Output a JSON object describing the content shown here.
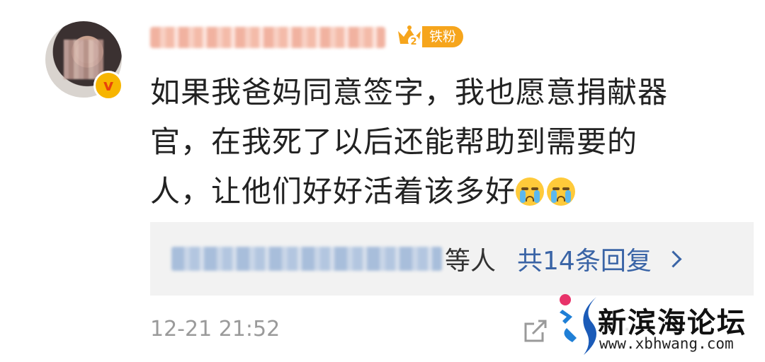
{
  "comment": {
    "text_lines": [
      "如果我爸妈同意签字，我也愿意捐献器",
      "官，在我死了以后还能帮助到需要的",
      "人，让他们好好活着该多好"
    ],
    "emoji_icons": [
      "crying-face-icon",
      "crying-face-icon"
    ],
    "fan_badge": {
      "level": "2",
      "label": "铁粉"
    },
    "replies": {
      "suffix": "等人",
      "total": "共14条回复"
    },
    "timestamp": "12-21 21:52"
  },
  "watermark": {
    "title": "新滨海论坛",
    "url": "www.xbhwang.com"
  },
  "colors": {
    "reply_link": "#3a64a6",
    "fan_badge": "#f6a51c",
    "verified_badge": "#f7b500",
    "timestamp": "#9a9a9a",
    "reply_bg": "#f2f2f2"
  }
}
